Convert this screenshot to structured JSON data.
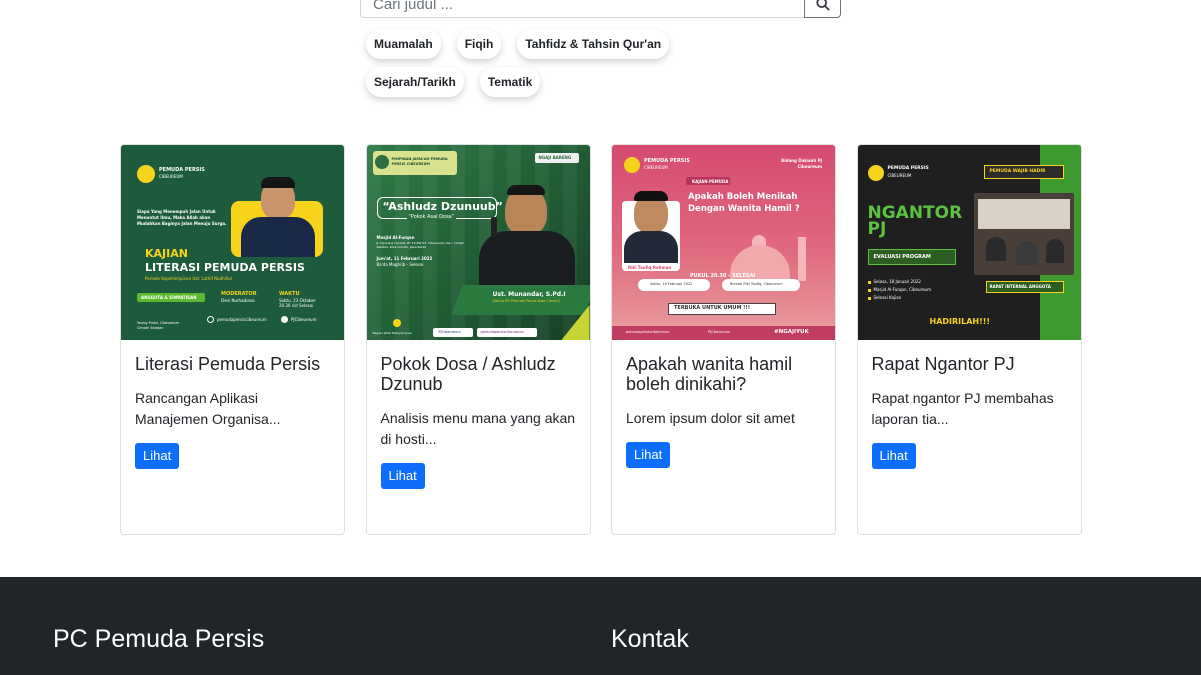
{
  "search": {
    "placeholder": "Cari judul ...",
    "icon": "search-icon"
  },
  "tags": [
    "Muamalah",
    "Fiqih",
    "Tahfidz & Tahsin Qur'an",
    "Sejarah/Tarikh",
    "Tematik"
  ],
  "cards": [
    {
      "title": "Literasi Pemuda Persis",
      "text": "Rancangan Aplikasi Manajemen Organisa...",
      "button": "Lihat",
      "poster": {
        "org": "PEMUDA PERSIS",
        "org_sub": "CIBEUREUM",
        "intro": "Siapa Yang Menempuh Jalan Untuk Menuntut Ilmu, Maka Allah akan Mudahkan Baginya Jalan Menuju Surga.",
        "kajian": "KAJIAN",
        "headline": "LITERASI PEMUDA PERSIS",
        "sub": "Periode Kepemimpinan Ust. Lathif Nadhifan",
        "badge": "ANGGOTA & SIMPATISAN",
        "moderator_label": "MODERATOR",
        "moderator": "Deni Nurhadiana",
        "waktu_label": "WAKTU",
        "waktu": "Sabtu, 23 Oktober 20.30 s/d Selesai",
        "place": "Young Pulse, Cibeureum Cimahi Selatan",
        "ig": "pemudapersiscibeureum",
        "fb": "PJCibeureum"
      }
    },
    {
      "title": "Pokok Dosa / Ashludz Dzunub",
      "text": "Analisis menu mana yang akan di hosti...",
      "button": "Lihat",
      "poster": {
        "org": "PIMPINAN JAMA'AH PEMUDA PERSIS CIBEUREUM",
        "tag": "NGAJI BARENG",
        "headline": "“Ashludz Dzunuub”",
        "sub": "“Pokok Asal Dosa”",
        "venue": "Masjid Al-Furqan",
        "venue_detail": "Jl. Cipinang Ciputat, RT 10 RW 03, Cibeureum, Kec. Cimahi Selatan, Kota Cimahi, Jawa Barat",
        "date": "Jum'at, 11 Februari 2022",
        "time": "Ba'da Maghrib - Selesai",
        "speaker": "Ust. Munandar, S.Pd.I",
        "speaker_role": "(Ketua PD Pemuda Persis Kota Cimahi)",
        "footer_org": "Bagian Jihaz Tarbiyah Jiwa",
        "fb": "PJCibeureum",
        "ig": "pemudapersiscibeureum"
      }
    },
    {
      "title": "Apakah wanita hamil boleh dinikahi?",
      "text": "Lorem ipsum dolor sit amet",
      "button": "Lihat",
      "poster": {
        "org": "PEMUDA PERSIS",
        "org_sub": "CIBEUREUM",
        "dept": "Bidang Dakwah PJ Cibeureum",
        "label": "KAJIAN PEMUDA",
        "headline": "Apakah Boleh Menikah Dengan Wanita Hamil ?",
        "speaker": "Riki Taufiq Rahman",
        "time": "PUKUL 20.30 – SELESAI",
        "date": "Sabtu, 19 Februari 2022",
        "place": "Rumah Riki Taufiq, Cibeureum",
        "open": "TERBUKA UNTUK UMUM !!!",
        "ig": "pemudapersiscibeureum",
        "fb": "PJCibeureum",
        "hashtag": "#NGAJIYUK"
      }
    },
    {
      "title": "Rapat Ngantor PJ",
      "text": "Rapat ngantor PJ membahas laporan tia...",
      "button": "Lihat",
      "poster": {
        "org": "PEMUDA PERSIS",
        "org_sub": "CIBEUREUM",
        "banner": "PEMUDA WAJIB HADIR",
        "headline": "NGANTOR PJ",
        "eval": "EVALUASI PROGRAM",
        "date": "Selasa, 18 Januari 2022",
        "venue": "Masjid Al-Furqan, Cibeureum",
        "time": "Selesai Kajian",
        "rapat": "RAPAT INTERNAL ANGGOTA",
        "hadir": "HADIRILAH!!!"
      }
    }
  ],
  "footer": {
    "left_title": "PC Pemuda Persis",
    "right_title": "Kontak"
  },
  "colors": {
    "primary": "#0d6efd",
    "footer_bg": "#212529",
    "poster1_bg": "#1e5b3c",
    "poster1_accent": "#f7d31c",
    "poster2_bg": "#2c6e40",
    "poster3_bg": "#d94e6f",
    "poster4_bg": "#222222",
    "poster4_green": "#3c9a2f"
  }
}
